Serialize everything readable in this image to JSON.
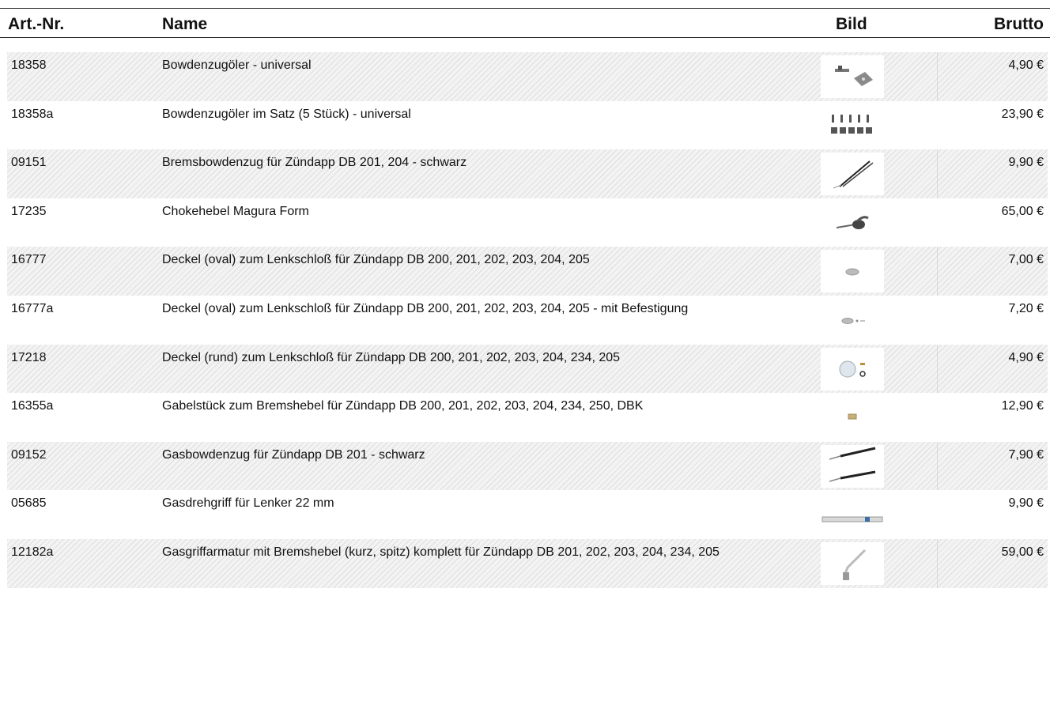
{
  "page_title_partial": "",
  "header": {
    "art": "Art.-Nr.",
    "name": "Name",
    "bild": "Bild",
    "brutto": "Brutto"
  },
  "rows": [
    {
      "art": "18358",
      "name": "Bowdenzugöler - universal",
      "price": "4,90 €",
      "image": "cable-oiler-thumbnail"
    },
    {
      "art": "18358a",
      "name": "Bowdenzugöler im Satz (5 Stück) - universal",
      "price": "23,90 €",
      "image": "cable-oiler-set-thumbnail"
    },
    {
      "art": "09151",
      "name": "Bremsbowdenzug für Zündapp DB 201, 204 - schwarz",
      "price": "9,90 €",
      "image": "brake-cable-thumbnail"
    },
    {
      "art": "17235",
      "name": "Chokehebel Magura Form",
      "price": "65,00 €",
      "image": "choke-lever-thumbnail"
    },
    {
      "art": "16777",
      "name": "Deckel (oval) zum Lenkschloß für Zündapp DB 200, 201, 202, 203, 204, 205",
      "price": "7,00 €",
      "image": "oval-cover-thumbnail"
    },
    {
      "art": "16777a",
      "name": "Deckel (oval) zum Lenkschloß für Zündapp DB 200, 201, 202, 203, 204, 205 - mit Befestigung",
      "price": "7,20 €",
      "image": "oval-cover-with-fixing-thumbnail"
    },
    {
      "art": "17218",
      "name": "Deckel (rund) zum Lenkschloß für Zündapp DB 200, 201, 202, 203, 204, 234, 205",
      "price": "4,90 €",
      "image": "round-cover-thumbnail"
    },
    {
      "art": "16355a",
      "name": "Gabelstück zum Bremshebel für Zündapp DB 200, 201, 202, 203, 204, 234, 250, DBK",
      "price": "12,90 €",
      "image": "fork-piece-thumbnail"
    },
    {
      "art": "09152",
      "name": "Gasbowdenzug für Zündapp DB 201 - schwarz",
      "price": "7,90 €",
      "image": "throttle-cable-thumbnail"
    },
    {
      "art": "05685",
      "name": "Gasdrehgriff für Lenker 22 mm",
      "price": "9,90 €",
      "image": "throttle-grip-thumbnail"
    },
    {
      "art": "12182a",
      "name": "Gasgriffarmatur mit Bremshebel (kurz, spitz) komplett für Zündapp DB 201, 202, 203, 204, 234, 205",
      "price": "59,00 €",
      "image": "throttle-brake-lever-assembly-thumbnail"
    }
  ]
}
